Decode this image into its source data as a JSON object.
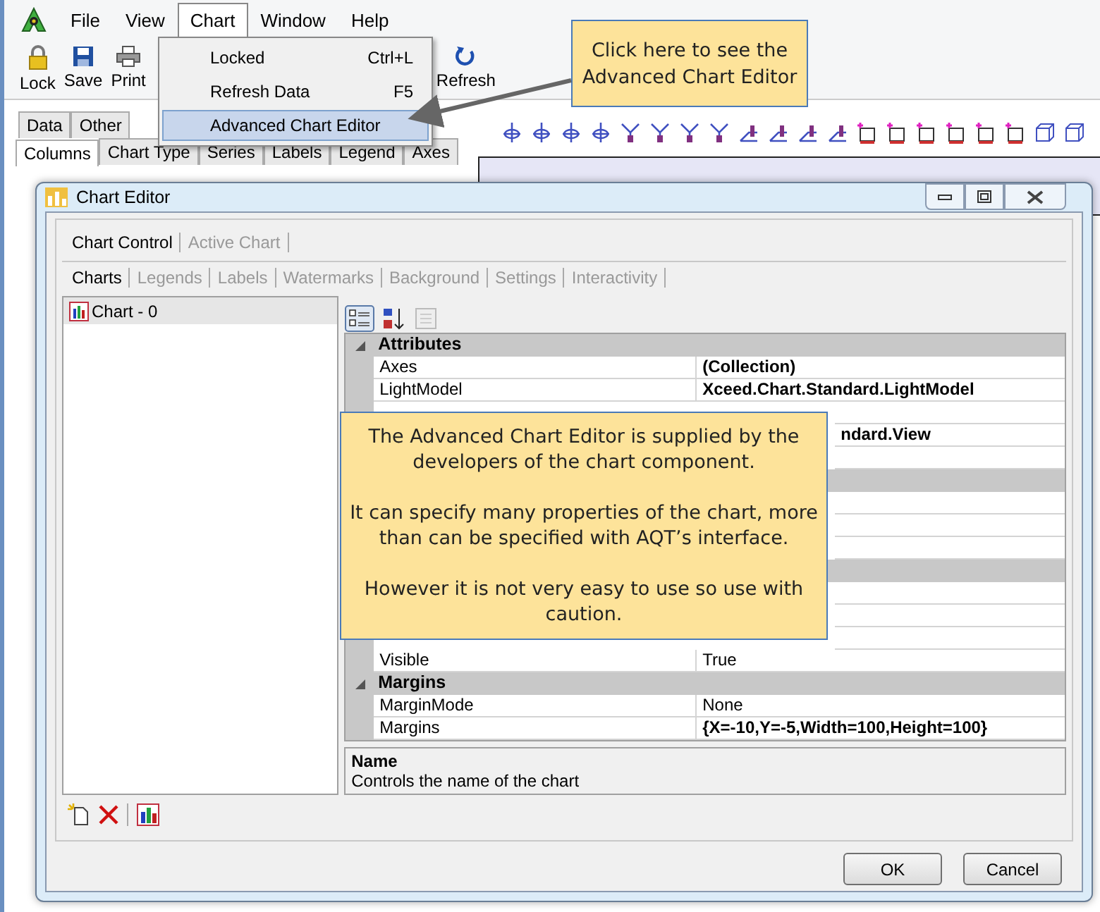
{
  "menu_bar": [
    {
      "label": "File",
      "selected": false
    },
    {
      "label": "View",
      "selected": false
    },
    {
      "label": "Chart",
      "selected": true
    },
    {
      "label": "Window",
      "selected": false
    },
    {
      "label": "Help",
      "selected": false
    }
  ],
  "toolbar": [
    {
      "label": "Lock",
      "kind": "lock"
    },
    {
      "label": "Save",
      "kind": "save"
    },
    {
      "label": "Print",
      "kind": "print"
    },
    {
      "label": "Refresh",
      "kind": "refresh"
    }
  ],
  "panel_tabs_back": [
    {
      "label": "Data",
      "selected": false
    },
    {
      "label": "Other",
      "selected": false
    }
  ],
  "panel_tabs_front": [
    {
      "label": "Columns",
      "selected": true
    },
    {
      "label": "Chart Type",
      "selected": false
    },
    {
      "label": "Series",
      "selected": false
    },
    {
      "label": "Labels",
      "selected": false
    },
    {
      "label": "Legend",
      "selected": false
    },
    {
      "label": "Axes",
      "selected": false
    }
  ],
  "chart_menu": [
    {
      "label": "Locked",
      "shortcut": "Ctrl+L",
      "selected": false
    },
    {
      "label": "Refresh Data",
      "shortcut": "F5",
      "selected": false
    },
    {
      "label": "Advanced Chart Editor",
      "selected": true
    }
  ],
  "dialog": {
    "title": "Chart Editor",
    "tabs": [
      {
        "label": "Chart Control",
        "selected": true
      },
      {
        "label": "Active Chart",
        "selected": false
      }
    ],
    "subtabs": [
      {
        "label": "Charts",
        "selected": true
      },
      {
        "label": "Legends",
        "selected": false
      },
      {
        "label": "Labels",
        "selected": false
      },
      {
        "label": "Watermarks",
        "selected": false
      },
      {
        "label": "Background",
        "selected": false
      },
      {
        "label": "Settings",
        "selected": false
      },
      {
        "label": "Interactivity",
        "selected": false
      }
    ],
    "charts": [
      {
        "label": "Chart - 0",
        "selected": true
      }
    ],
    "properties": [
      {
        "kind": "category",
        "name": "Attributes",
        "expanded": true
      },
      {
        "kind": "property",
        "name": "Axes",
        "value": "(Collection)",
        "changed": true
      },
      {
        "kind": "property",
        "name": "LightModel",
        "value": "Xceed.Chart.Standard.LightModel",
        "changed": true
      },
      {
        "kind": "property"
      },
      {
        "kind": "property",
        "value": "ndard.View",
        "changed": true,
        "covered": true
      },
      {
        "kind": "property"
      },
      {
        "kind": "category"
      },
      {
        "kind": "property"
      },
      {
        "kind": "property"
      },
      {
        "kind": "property"
      },
      {
        "kind": "category"
      },
      {
        "kind": "property"
      },
      {
        "kind": "property"
      },
      {
        "kind": "property"
      },
      {
        "kind": "property",
        "name": "Visible",
        "value": "True",
        "changed": false
      },
      {
        "kind": "category",
        "name": "Margins",
        "expanded": true
      },
      {
        "kind": "property",
        "name": "MarginMode",
        "value": "None",
        "changed": false
      },
      {
        "kind": "property",
        "name": "Margins",
        "value": "{X=-10,Y=-5,Width=100,Height=100}",
        "changed": true
      }
    ],
    "description": {
      "title": "Name",
      "text": "Controls the name of the chart"
    },
    "buttons": [
      "OK",
      "Cancel"
    ]
  },
  "callouts": [
    {
      "kind": "menu",
      "paragraphs": [
        "Click here to see the Advanced Chart Editor"
      ]
    },
    {
      "kind": "grid",
      "paragraphs": [
        "The Advanced Chart Editor is supplied by the developers of the chart component.",
        "It can specify many properties of the chart, more than can be specified with AQT’s interface.",
        "However it is not very easy to use so use with caution."
      ]
    }
  ]
}
